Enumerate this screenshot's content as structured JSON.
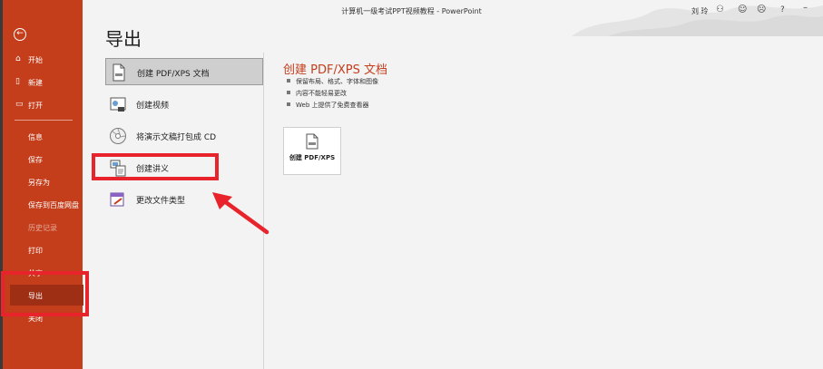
{
  "titlebar": {
    "title": "计算机一级考试PPT视频教程 - PowerPoint",
    "user": "刘 玲",
    "icons": [
      "person-icon",
      "smiley-icon",
      "frown-icon",
      "help-icon",
      "minimize-icon"
    ],
    "help_label": "?"
  },
  "sidebar": {
    "back_icon": "back-arrow-icon",
    "back_glyph": "←",
    "top_items": [
      {
        "label": "开始",
        "icon": "home-icon"
      },
      {
        "label": "新建",
        "icon": "new-doc-icon"
      },
      {
        "label": "打开",
        "icon": "folder-icon"
      }
    ],
    "items": [
      "信息",
      "保存",
      "另存为",
      "保存到百度网盘",
      "历史记录",
      "打印",
      "共享",
      "导出",
      "关闭"
    ],
    "active": "导出",
    "color": "#c43e1c"
  },
  "main": {
    "title": "导出",
    "options": [
      {
        "label": "创建 PDF/XPS 文档",
        "icon": "pdf-doc-icon"
      },
      {
        "label": "创建视频",
        "icon": "video-icon"
      },
      {
        "label": "将演示文稿打包成 CD",
        "icon": "cd-icon"
      },
      {
        "label": "创建讲义",
        "icon": "handout-icon"
      },
      {
        "label": "更改文件类型",
        "icon": "file-type-icon"
      }
    ],
    "detail": {
      "title": "创建 PDF/XPS 文档",
      "bullets": [
        "保留布局、格式、字体和图像",
        "内容不能轻易更改",
        "Web 上提供了免费查看器"
      ],
      "button_label": "创建 PDF/XPS"
    }
  },
  "annotation_color": "#e8232b"
}
